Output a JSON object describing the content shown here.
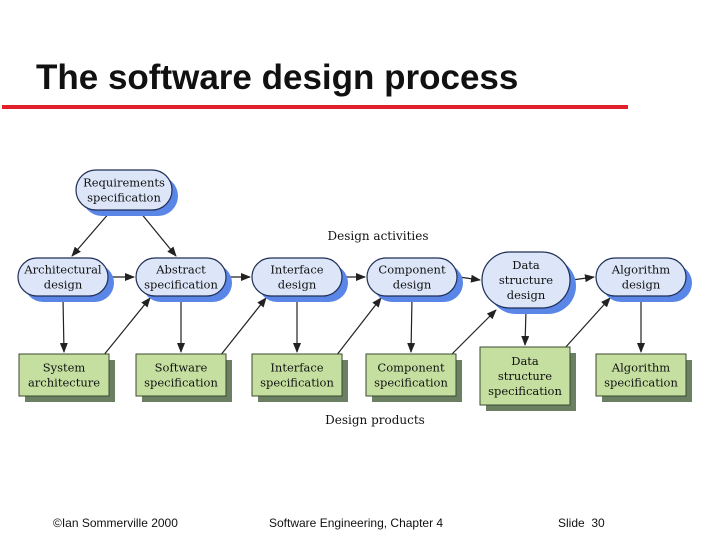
{
  "slide": {
    "title": "The software design process"
  },
  "diagram": {
    "start": {
      "id": "req",
      "lines": [
        "Requirements",
        "specification"
      ]
    },
    "activities_label": "Design activities",
    "products_label": "Design products",
    "activities": [
      {
        "id": "arch",
        "lines": [
          "Architectural",
          "design"
        ]
      },
      {
        "id": "abs",
        "lines": [
          "Abstract",
          "specification"
        ]
      },
      {
        "id": "intd",
        "lines": [
          "Interface",
          "design"
        ]
      },
      {
        "id": "compd",
        "lines": [
          "Component",
          "design"
        ]
      },
      {
        "id": "datad",
        "lines": [
          "Data",
          "structure",
          "design"
        ]
      },
      {
        "id": "algd",
        "lines": [
          "Algorithm",
          "design"
        ]
      }
    ],
    "products": [
      {
        "id": "sysarch",
        "lines": [
          "System",
          "architecture"
        ]
      },
      {
        "id": "swspec",
        "lines": [
          "Software",
          "specification"
        ]
      },
      {
        "id": "intspec",
        "lines": [
          "Interface",
          "specification"
        ]
      },
      {
        "id": "compspec",
        "lines": [
          "Component",
          "specification"
        ]
      },
      {
        "id": "dataspec",
        "lines": [
          "Data",
          "structure",
          "specification"
        ]
      },
      {
        "id": "algspec",
        "lines": [
          "Algorithm",
          "specification"
        ]
      }
    ],
    "colors": {
      "activity_fill": "#dce6f8",
      "activity_shadow": "#5a86e8",
      "product_fill": "#c5dfa0",
      "product_shadow": "#6b7f62",
      "arrow": "#222222",
      "rule": "#e0202a"
    }
  },
  "footer": {
    "copyright": "©Ian Sommerville 2000",
    "book": "Software Engineering, Chapter 4",
    "slide_label": "Slide",
    "slide_number": "30"
  }
}
